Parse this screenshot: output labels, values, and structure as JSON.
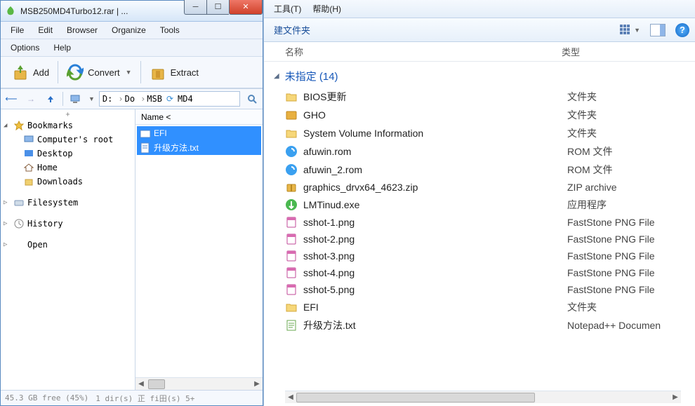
{
  "archive": {
    "title": "MSB250MD4Turbo12.rar | ...",
    "menu1": [
      "File",
      "Edit",
      "Browser",
      "Organize",
      "Tools"
    ],
    "menu2": [
      "Options",
      "Help"
    ],
    "toolbar": {
      "add": "Add",
      "convert": "Convert",
      "extract": "Extract"
    },
    "path": {
      "drive": "D:",
      "p1": "Do",
      "p2": "MSB",
      "p3": "MD4"
    },
    "sidebar": {
      "bookmarks": "Bookmarks",
      "items": [
        "Computer's root",
        "Desktop",
        "Home",
        "Downloads"
      ],
      "filesystem": "Filesystem",
      "history": "History",
      "open": "Open"
    },
    "filehdr": "Name <",
    "files": [
      {
        "name": "EFI",
        "type": "folder"
      },
      {
        "name": "升级方法.txt",
        "type": "txt"
      }
    ],
    "status": {
      "left": "45.3 GB free (45%)",
      "right": "1 dir(s) 正 fi田(s) 5+"
    }
  },
  "explorer": {
    "menu": [
      {
        "label": "工具(T)"
      },
      {
        "label": "帮助(H)"
      }
    ],
    "newfolder": "建文件夹",
    "columns": {
      "name": "名称",
      "type": "类型"
    },
    "group": "未指定 (14)",
    "items": [
      {
        "name": "BIOS更新",
        "type": "文件夹",
        "icon": "folder"
      },
      {
        "name": "GHO",
        "type": "文件夹",
        "icon": "folder-gold"
      },
      {
        "name": "System Volume Information",
        "type": "文件夹",
        "icon": "folder"
      },
      {
        "name": "afuwin.rom",
        "type": "ROM 文件",
        "icon": "rom"
      },
      {
        "name": "afuwin_2.rom",
        "type": "ROM 文件",
        "icon": "rom"
      },
      {
        "name": "graphics_drvx64_4623.zip",
        "type": "ZIP archive",
        "icon": "zip"
      },
      {
        "name": "LMTinud.exe",
        "type": "应用程序",
        "icon": "exe"
      },
      {
        "name": "sshot-1.png",
        "type": "FastStone PNG File",
        "icon": "png"
      },
      {
        "name": "sshot-2.png",
        "type": "FastStone PNG File",
        "icon": "png"
      },
      {
        "name": "sshot-3.png",
        "type": "FastStone PNG File",
        "icon": "png"
      },
      {
        "name": "sshot-4.png",
        "type": "FastStone PNG File",
        "icon": "png"
      },
      {
        "name": "sshot-5.png",
        "type": "FastStone PNG File",
        "icon": "png"
      },
      {
        "name": "EFI",
        "type": "文件夹",
        "icon": "folder"
      },
      {
        "name": "升级方法.txt",
        "type": "Notepad++ Documen",
        "icon": "txt"
      }
    ]
  }
}
